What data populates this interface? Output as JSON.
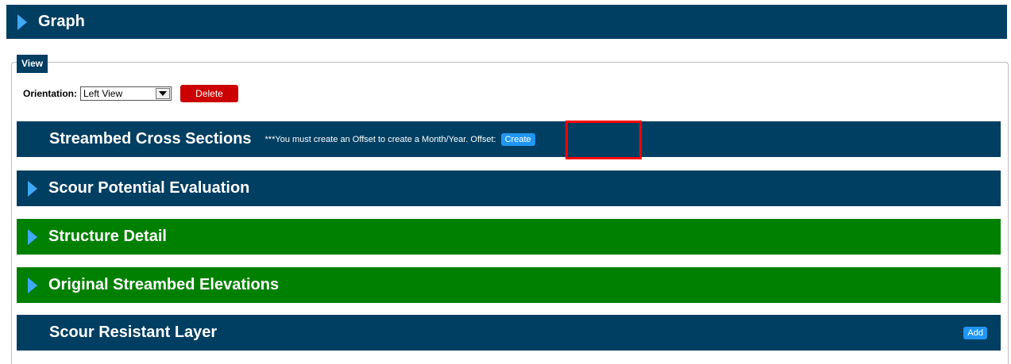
{
  "header": {
    "title": "Graph",
    "icon": "chevron-right-icon"
  },
  "view": {
    "legend": "View",
    "orientation_label": "Orientation:",
    "orientation_value": "Left View",
    "delete_label": "Delete"
  },
  "sections": {
    "streambed": {
      "title": "Streambed Cross Sections",
      "notice": "***You must create an Offset to create a Month/Year. Offset:",
      "create_label": "Create"
    },
    "scour_potential": {
      "title": "Scour Potential Evaluation"
    },
    "structure_detail": {
      "title": "Structure Detail"
    },
    "original_elevations": {
      "title": "Original Streambed Elevations"
    },
    "scour_resistant": {
      "title": "Scour Resistant Layer",
      "add_label": "Add"
    }
  },
  "colors": {
    "navy": "#003e62",
    "green": "#008000",
    "accent_blue": "#3fa9f5",
    "button_blue": "#2196f3",
    "delete_red": "#cc0000",
    "highlight_red": "#ff0000"
  }
}
